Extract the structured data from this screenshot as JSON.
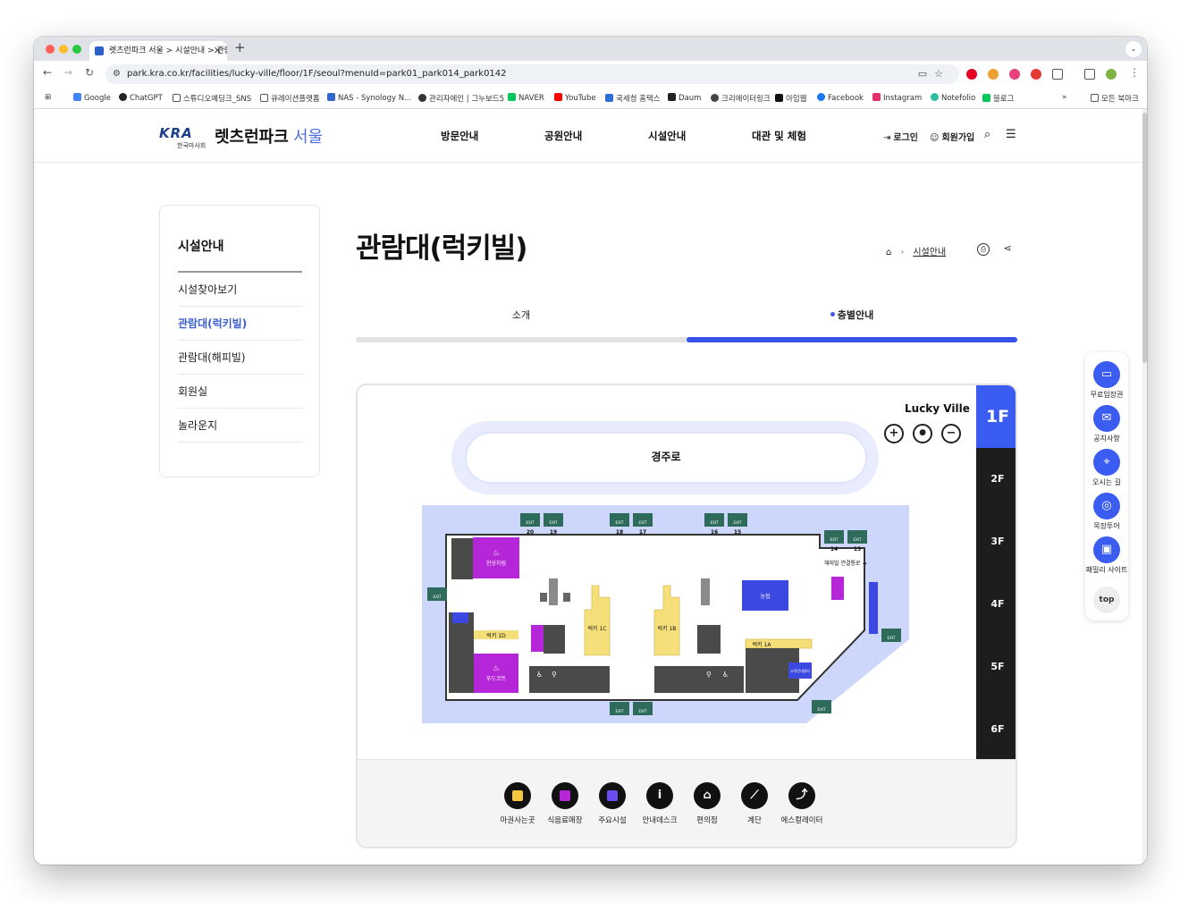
{
  "browser": {
    "tab_title": "렛츠런파크 서울 > 시설안내 > 관람",
    "url": "park.kra.co.kr/facilities/lucky-ville/floor/1F/seoul?menuId=park01_park014_park0142",
    "bookmarks": [
      "Google",
      "ChatGPT",
      "스튜디오예딩크_SNS",
      "큐레이션플랫폼",
      "NAS - Synology N...",
      "관리자에인 | 그누보드5",
      "NAVER",
      "YouTube",
      "국세청 홈택스",
      "Daum",
      "크리에이터링크",
      "아임웹",
      "Facebook",
      "Instagram",
      "Notefolio",
      "블로그"
    ],
    "bookmarks_more": "»",
    "all_bookmarks": "모든 북마크",
    "colors": {
      "tabbar": "#dfe2e7",
      "close": "#ff5f57",
      "minimize": "#febc2e",
      "maximize": "#28c840"
    }
  },
  "header": {
    "logo_mark": "KRA",
    "logo_sub": "한국마사회",
    "logo_main": "렛츠런파크",
    "logo_city": "서울",
    "nav": [
      "방문안내",
      "공원안내",
      "시설안내",
      "대관 및 체험"
    ],
    "login": "로그인",
    "signup": "회원가입",
    "icons": [
      "login-icon",
      "user-add-icon",
      "search-icon",
      "menu-icon"
    ]
  },
  "sidebar": {
    "title": "시설안내",
    "items": [
      {
        "label": "시설찾아보기",
        "active": false
      },
      {
        "label": "관람대(럭키빌)",
        "active": true
      },
      {
        "label": "관람대(해피빌)",
        "active": false
      },
      {
        "label": "회원실",
        "active": false
      },
      {
        "label": "놀라운지",
        "active": false
      }
    ]
  },
  "page": {
    "title": "관람대(럭키빌)",
    "breadcrumb": "시설안내",
    "tabs": [
      {
        "label": "소개",
        "active": false
      },
      {
        "label": "층별안내",
        "active": true
      }
    ],
    "accent": "#3553e8"
  },
  "map": {
    "building": "Lucky Ville",
    "track": "경주로",
    "floors": [
      "1F",
      "2F",
      "3F",
      "4F",
      "5F",
      "6F"
    ],
    "current_floor": "1F",
    "zoom": [
      "+",
      "●",
      "−"
    ],
    "areas": {
      "food1": "한상차림",
      "food2": "푸드코트",
      "bank": "농협",
      "lucky1d": "럭키 1D",
      "lucky1c": "럭키 1C",
      "lucky1b": "럭키 1B",
      "lucky1a": "럭키 1A",
      "happy_link": "해피빌 연결통로 →",
      "info": "고객안내센터"
    },
    "exit_label": "EXIT",
    "exits_top": [
      "20",
      "19",
      "18",
      "17",
      "16",
      "15"
    ],
    "exits_right": [
      "14",
      "13"
    ],
    "colors": {
      "plaza": "#cdd6fb",
      "magenta": "#b526d9",
      "blue": "#3b49e0",
      "yellow": "#f5df7a",
      "gray": "#4a4a4a",
      "exit": "#2e6b5a"
    }
  },
  "legend": [
    {
      "label": "마권사는곳",
      "icon": "betting-icon",
      "color": "#f5c842"
    },
    {
      "label": "식음료매장",
      "icon": "food-icon",
      "color": "#b526d9"
    },
    {
      "label": "주요시설",
      "icon": "facility-icon",
      "color": "#6a4cf0"
    },
    {
      "label": "안내데스크",
      "icon": "info-icon",
      "glyph": "i"
    },
    {
      "label": "편의점",
      "icon": "basket-icon",
      "glyph": "⌂"
    },
    {
      "label": "계단",
      "icon": "stairs-icon",
      "glyph": "⟋"
    },
    {
      "label": "에스컬레이터",
      "icon": "escalator-icon",
      "glyph": "⤴"
    }
  ],
  "quickmenu": {
    "items": [
      {
        "label": "무료입장권",
        "icon": "ticket-icon",
        "glyph": "▭"
      },
      {
        "label": "공지사항",
        "icon": "megaphone-icon",
        "glyph": "✉"
      },
      {
        "label": "오시는 길",
        "icon": "location-icon",
        "glyph": "⌖"
      },
      {
        "label": "목장투어",
        "icon": "target-icon",
        "glyph": "◎"
      },
      {
        "label": "패밀리 사이트",
        "icon": "monitor-icon",
        "glyph": "▣"
      }
    ],
    "top": "top"
  }
}
